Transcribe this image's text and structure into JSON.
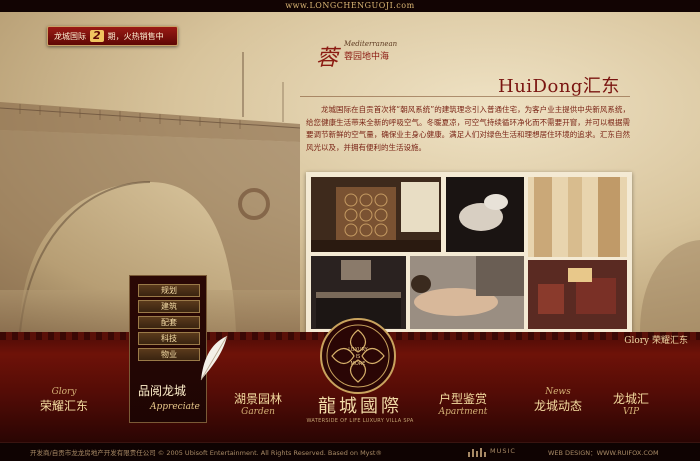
{
  "header": {
    "url": "www.LONGCHENGUOJI.com"
  },
  "promo": {
    "prefix": "龙城国际",
    "number": "2",
    "text": "期，火热销售中"
  },
  "logo": {
    "char": "蓉",
    "latin": "Mediterranean",
    "chinese": "蓉园地中海"
  },
  "section": {
    "title": "HuiDong汇东",
    "paragraph": "龙城国际在自贡首次将“朝风系统”的建筑理念引入普通住宅，为客户业主提供中央新风系统，给您健康生活带来全新的呼吸空气。冬暖夏凉，可空气持续循环净化而不需要开窗，并可以根据需要调节新鲜的空气量，确保业主身心健康。满足人们对绿色生活和理想居住环境的追求。汇东自然风光以及，并拥有便利的生活设施。"
  },
  "glory_right": "Glory 荣耀汇东",
  "submenu": {
    "items": [
      "规划",
      "建筑",
      "配套",
      "科技",
      "物业"
    ],
    "main_cn": "品阅龙城",
    "main_en": "Appreciate"
  },
  "nav": [
    {
      "en": "Glory",
      "cn": "荣耀汇东"
    },
    {
      "en": "",
      "cn": "湖景园林",
      "en2": "Garden"
    },
    {
      "en": "",
      "cn": "户型鉴赏",
      "en2": "Apartment"
    },
    {
      "en": "News",
      "cn": "龙城动态"
    },
    {
      "en": "",
      "cn": "龙城汇",
      "en2": "VIP"
    }
  ],
  "emblem": {
    "text_top": "LUXURY",
    "text_mid": "IS",
    "text_bot": "MORE"
  },
  "brand": {
    "cn": "龍城國際",
    "en": "WATERSIDE OF LIFE LUXURY VILLA SPA"
  },
  "footer": {
    "copyright": "开发商/自贡市龙龙房地产开发有限责任公司 © 2005 Ubisoft Entertainment. All Rights Reserved. Based on Myst®",
    "music": "MUSIC",
    "design": "WEB DESIGN：WWW.RUIFOX.COM"
  },
  "colors": {
    "accent": "#7a1410",
    "gold": "#d4b176",
    "bg": "#1a0604"
  }
}
